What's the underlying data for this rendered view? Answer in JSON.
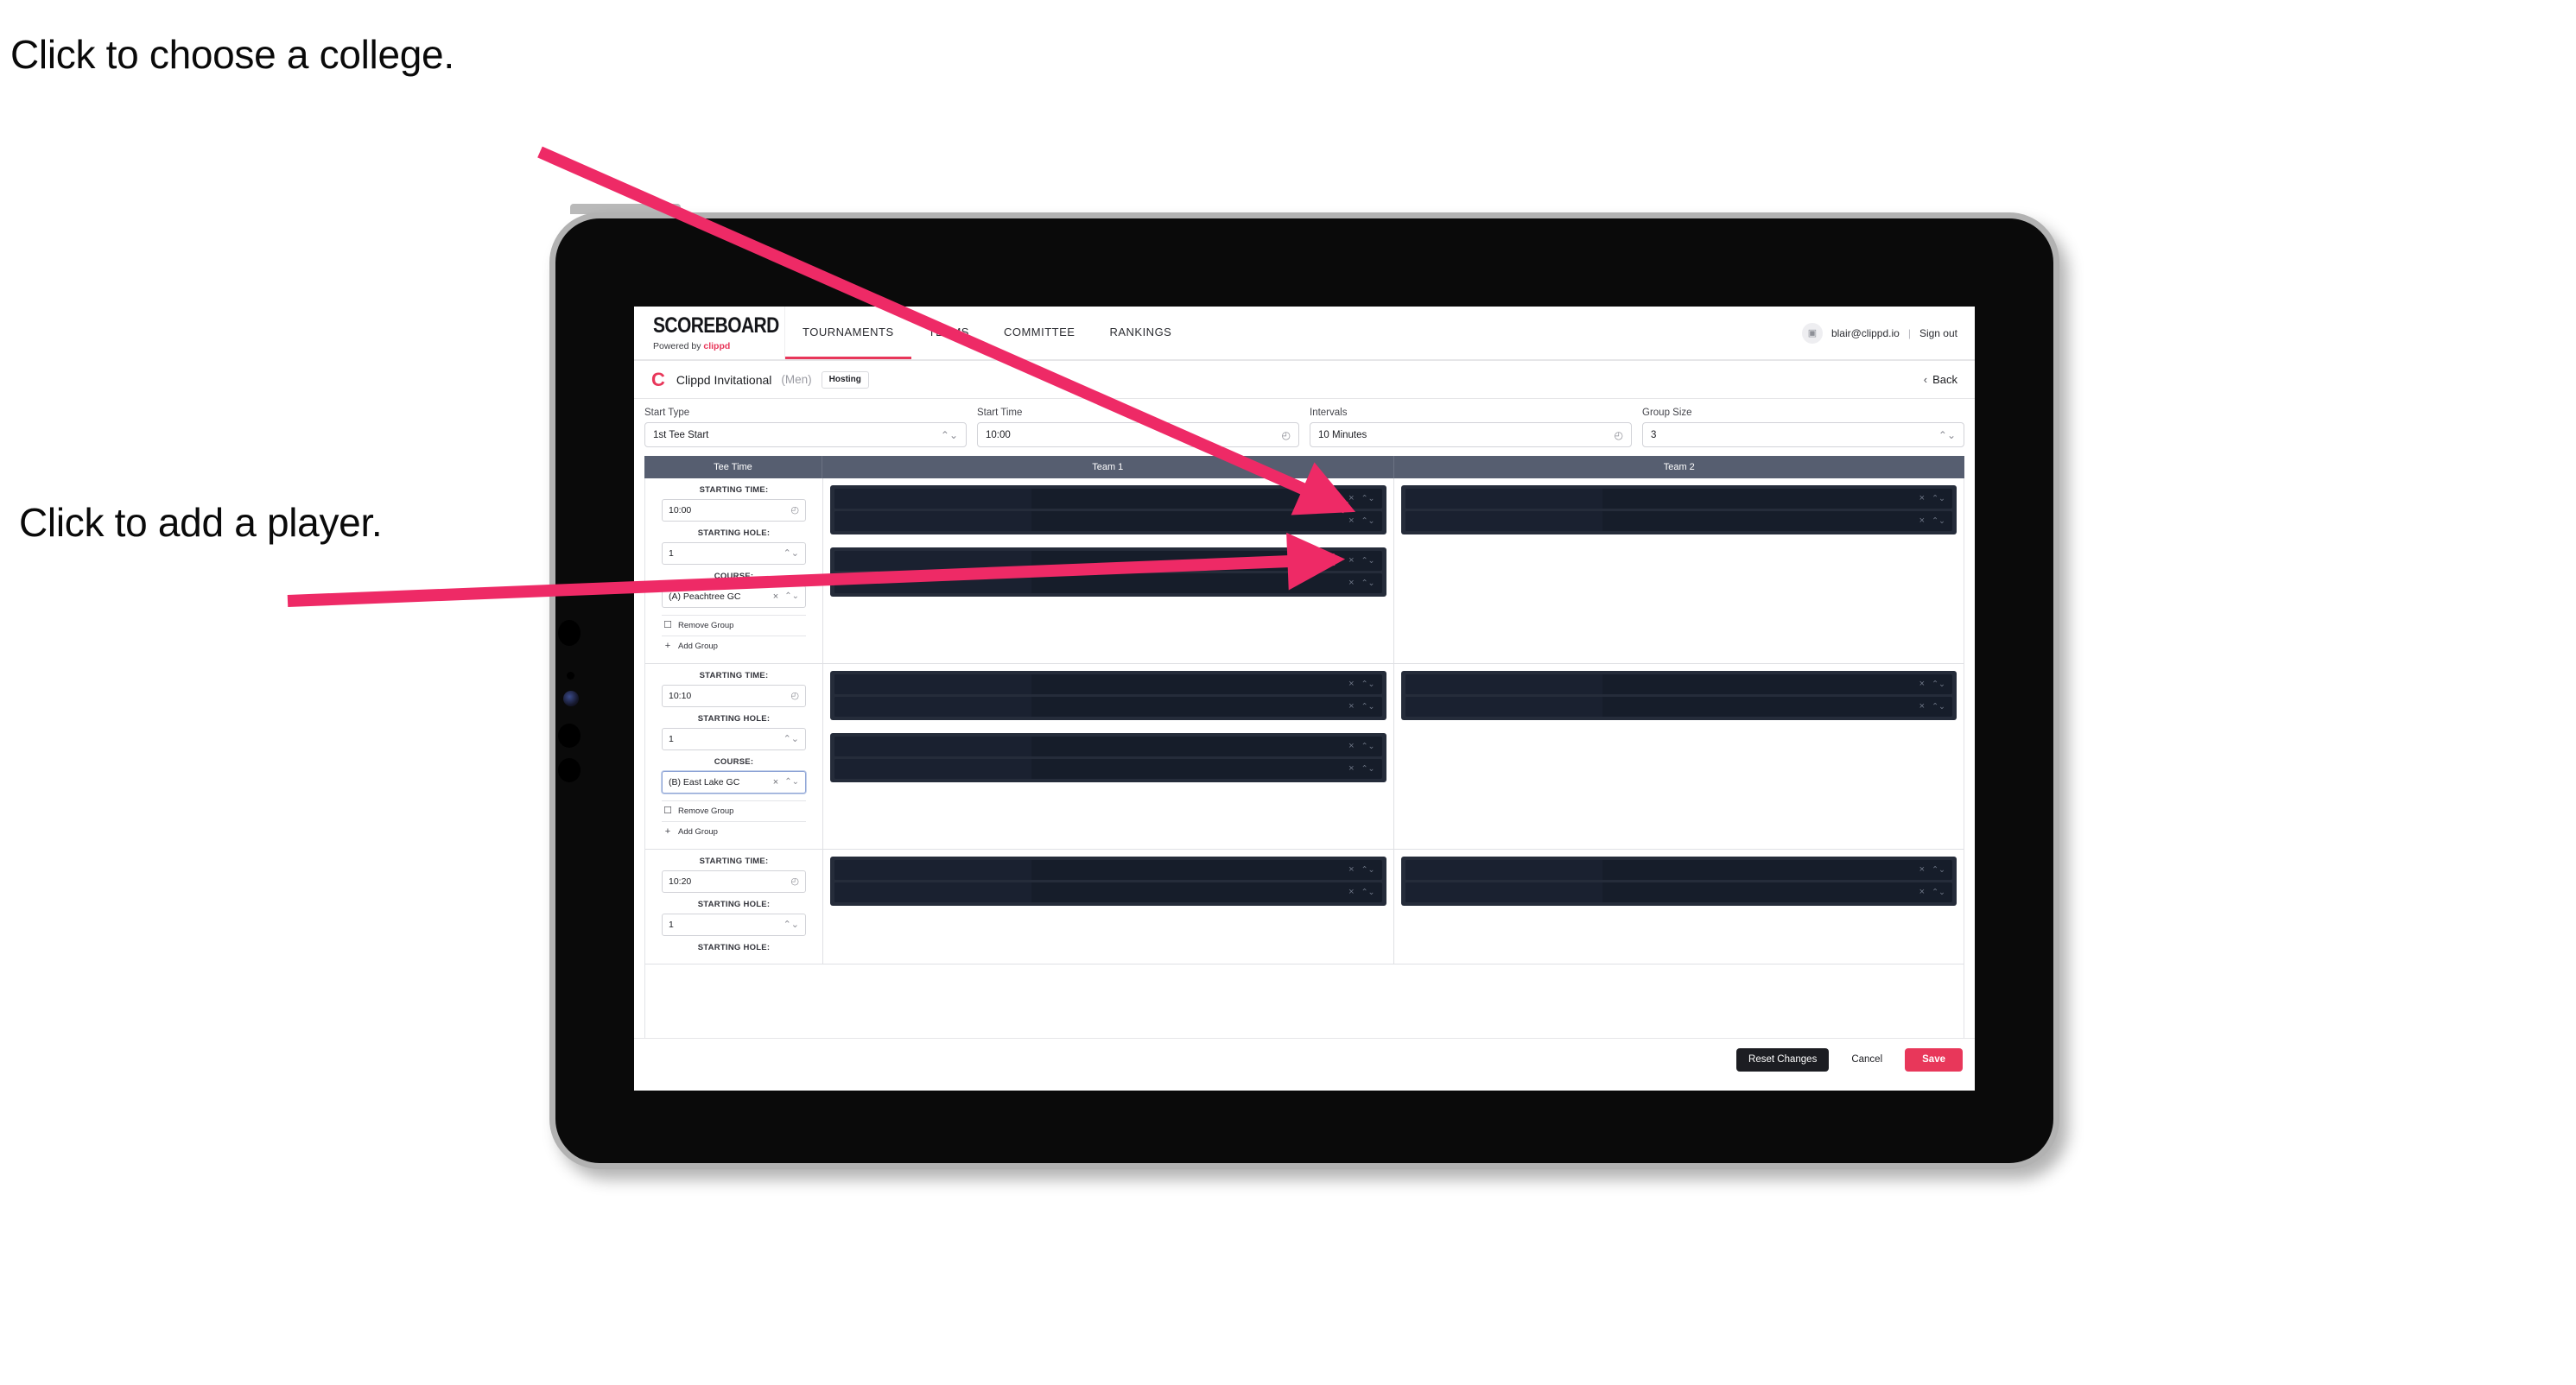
{
  "annotations": {
    "choose_college": "Click to choose a college.",
    "add_player": "Click to add a player."
  },
  "device": {
    "type": "tablet"
  },
  "topnav": {
    "brand_word": "SCOREBOARD",
    "brand_sub_prefix": "Powered by ",
    "brand_sub_name": "clippd",
    "tabs": [
      {
        "label": "TOURNAMENTS",
        "active": true
      },
      {
        "label": "TEAMS",
        "active": false
      },
      {
        "label": "COMMITTEE",
        "active": false
      },
      {
        "label": "RANKINGS",
        "active": false
      }
    ],
    "avatar_glyph": "▣",
    "email": "blair@clippd.io",
    "divider": "|",
    "sign_out": "Sign out"
  },
  "tourney": {
    "logo_letter": "C",
    "name": "Clippd Invitational",
    "gender": "(Men)",
    "badge": "Hosting",
    "back_chevron": "‹",
    "back_label": "Back"
  },
  "settings": {
    "fields": [
      {
        "label": "Start Type",
        "value": "1st Tee Start",
        "adorn": "⌃⌄",
        "adorn_kind": "stepper"
      },
      {
        "label": "Start Time",
        "value": "10:00",
        "adorn": "◴",
        "adorn_kind": "clock"
      },
      {
        "label": "Intervals",
        "value": "10 Minutes",
        "adorn": "◴",
        "adorn_kind": "clock"
      },
      {
        "label": "Group Size",
        "value": "3",
        "adorn": "⌃⌄",
        "adorn_kind": "stepper"
      }
    ]
  },
  "table": {
    "headers": {
      "tee_time": "Tee Time",
      "team1": "Team 1",
      "team2": "Team 2"
    },
    "labels": {
      "starting_time": "STARTING TIME:",
      "starting_hole": "STARTING HOLE:",
      "course": "COURSE:",
      "remove_group": "Remove Group",
      "add_group": "Add Group",
      "remove_icon": "☐",
      "add_icon": "+",
      "clock_icon": "◴",
      "stepper_icon": "⌃⌄",
      "clear_icon": "×",
      "slot_clear_icon": "×",
      "slot_stepper_icon": "⌃⌄"
    },
    "groups": [
      {
        "starting_time": "10:00",
        "starting_hole": "1",
        "course": "(A) Peachtree GC",
        "course_focused": false,
        "team1_panels": [
          {
            "slots": 2
          },
          {
            "slots": 2
          }
        ],
        "team2_panels": [
          {
            "slots": 2
          }
        ]
      },
      {
        "starting_time": "10:10",
        "starting_hole": "1",
        "course": "(B) East Lake GC",
        "course_focused": true,
        "team1_panels": [
          {
            "slots": 2
          },
          {
            "slots": 2
          }
        ],
        "team2_panels": [
          {
            "slots": 2
          }
        ]
      },
      {
        "starting_time": "10:20",
        "starting_hole": "1",
        "course": "",
        "course_focused": false,
        "team1_panels": [
          {
            "slots": 2
          }
        ],
        "team2_panels": [
          {
            "slots": 2
          }
        ]
      }
    ]
  },
  "footer": {
    "reset": "Reset Changes",
    "cancel": "Cancel",
    "save": "Save"
  },
  "colors": {
    "accent": "#e8375a",
    "header_bar": "#565e70",
    "panel_dark": "#252c3a",
    "slot_dark": "#161d2a",
    "arrow": "#ee2a66"
  }
}
